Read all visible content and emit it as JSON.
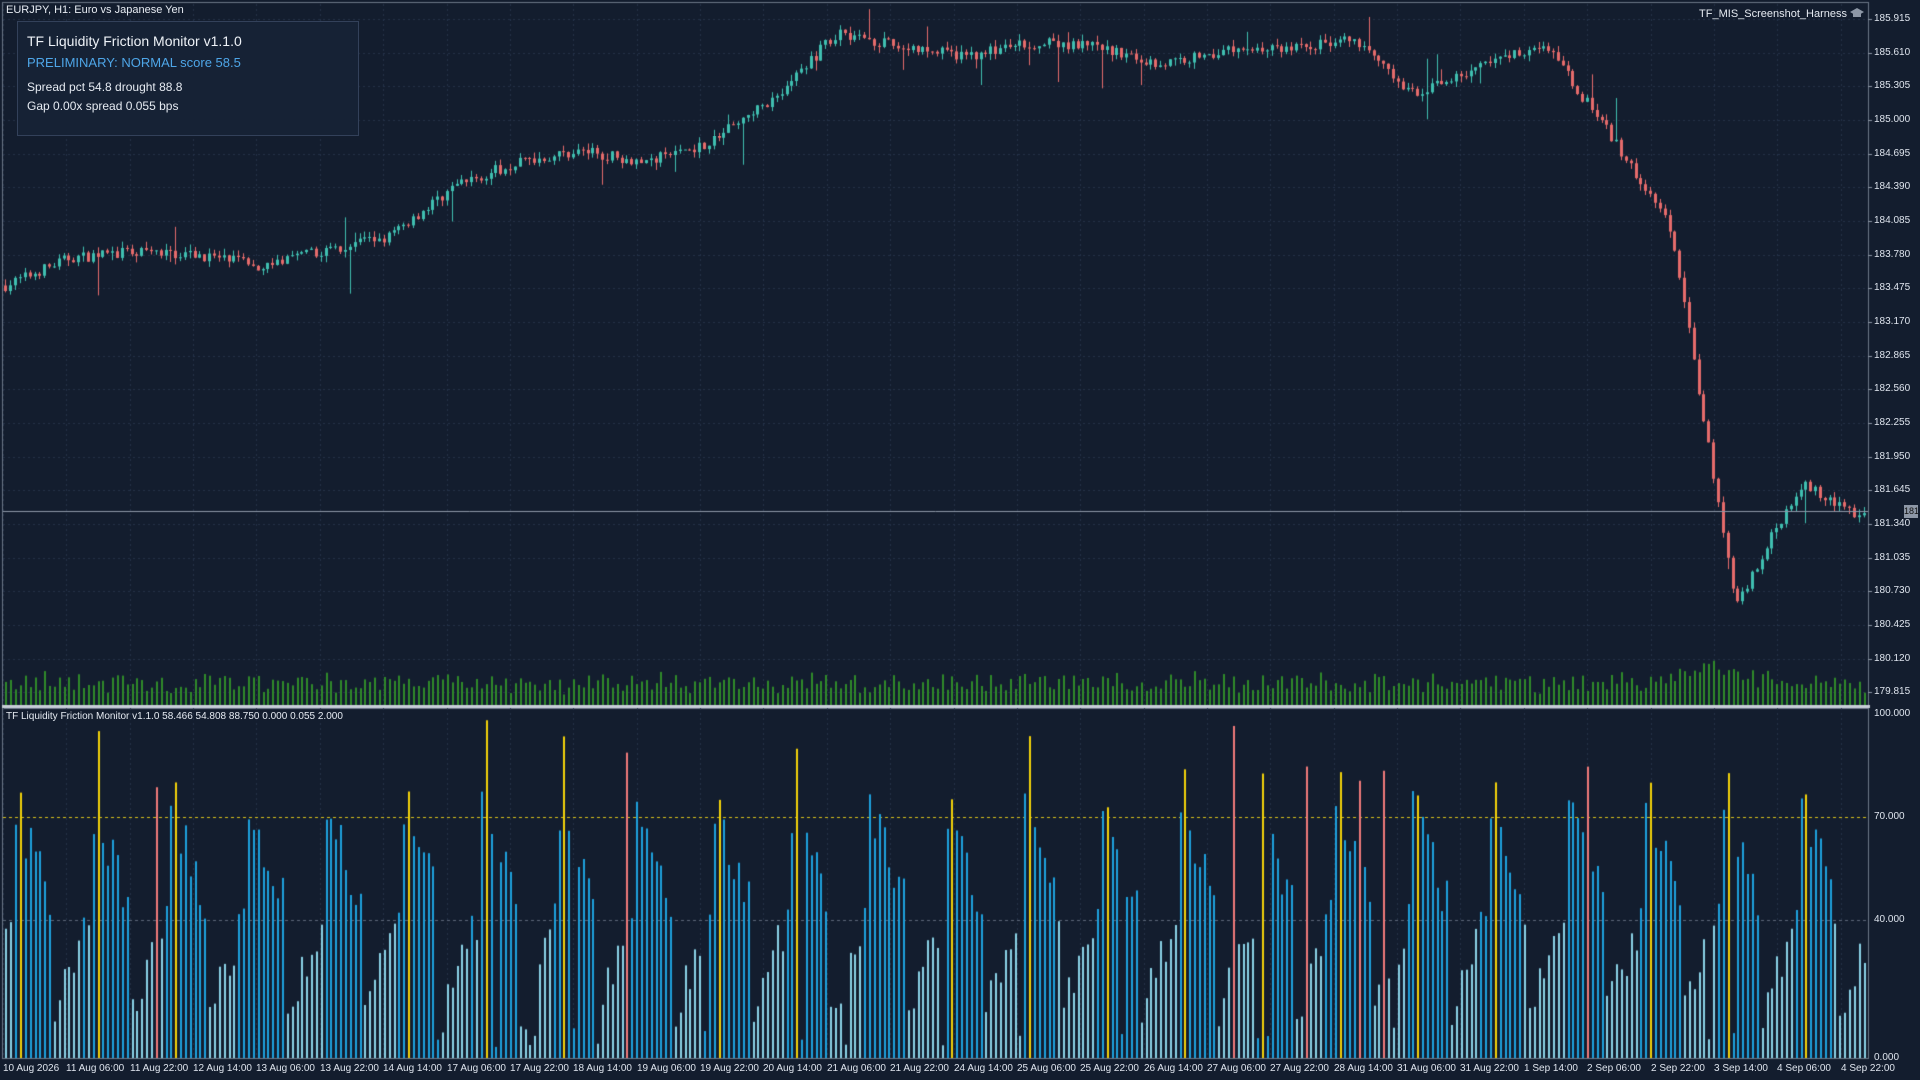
{
  "chart_title": "EURJPY, H1:  Euro vs Japanese Yen",
  "harness_label": "TF_MIS_Screenshot_Harness",
  "harness_icon": "graduation-cap-icon",
  "panel": {
    "title": "TF Liquidity Friction Monitor  v1.1.0",
    "status": "PRELIMINARY: NORMAL  score 58.5",
    "line1": "Spread pct 54.8   drought 88.8",
    "line2": "Gap 0.00x   spread 0.055 bps"
  },
  "subwindow_title": "TF Liquidity Friction Monitor v1.1.0 58.466 54.808 88.750 0.000 0.055 2.000",
  "current_price": "181.4??",
  "colors": {
    "background": "#131d2e",
    "bull_candle": "#3fbfb0",
    "bear_candle": "#e56b6b",
    "volume": "#2f8a2a",
    "bar_blue": "#1ea0dc",
    "bar_light": "#8ad2e6",
    "bar_yellow": "#f2d20a",
    "bar_red": "#f07a7a",
    "level_70": "#d9c21a"
  },
  "price_axis": [
    "185.915",
    "185.610",
    "185.305",
    "185.000",
    "184.695",
    "184.390",
    "184.085",
    "183.780",
    "183.475",
    "183.170",
    "182.865",
    "182.560",
    "182.255",
    "181.950",
    "181.645",
    "181.340",
    "181.035",
    "180.730",
    "180.425",
    "180.120",
    "179.815"
  ],
  "indicator_axis": [
    "100.000",
    "70.000",
    "40.000",
    "0.000"
  ],
  "time_axis": [
    "10 Aug 2026",
    "11 Aug 06:00",
    "11 Aug 22:00",
    "12 Aug 14:00",
    "13 Aug 06:00",
    "13 Aug 22:00",
    "14 Aug 14:00",
    "17 Aug 06:00",
    "17 Aug 22:00",
    "18 Aug 14:00",
    "19 Aug 06:00",
    "19 Aug 22:00",
    "20 Aug 14:00",
    "21 Aug 06:00",
    "21 Aug 22:00",
    "24 Aug 14:00",
    "25 Aug 06:00",
    "25 Aug 22:00",
    "26 Aug 14:00",
    "27 Aug 06:00",
    "27 Aug 22:00",
    "28 Aug 14:00",
    "31 Aug 06:00",
    "31 Aug 22:00",
    "1 Sep 14:00",
    "2 Sep 06:00",
    "2 Sep 22:00",
    "3 Sep 14:00",
    "4 Sep 06:00",
    "4 Sep 22:00"
  ],
  "chart_data": [
    {
      "type": "candlestick",
      "title": "EURJPY, H1:  Euro vs Japanese Yen",
      "timeframe": "H1",
      "x_range": [
        "10 Aug 2026",
        "4 Sep 22:00"
      ],
      "ylim": [
        179.7,
        186.05
      ],
      "approx_close_path": {
        "x": [
          "10 Aug 2026",
          "11 Aug 06:00",
          "11 Aug 22:00",
          "12 Aug 14:00",
          "13 Aug 06:00",
          "13 Aug 22:00",
          "14 Aug 14:00",
          "17 Aug 06:00",
          "17 Aug 22:00",
          "18 Aug 14:00",
          "19 Aug 06:00",
          "19 Aug 22:00",
          "20 Aug 14:00",
          "21 Aug 06:00",
          "21 Aug 22:00",
          "24 Aug 14:00",
          "25 Aug 06:00",
          "25 Aug 22:00",
          "26 Aug 14:00",
          "27 Aug 06:00",
          "27 Aug 22:00",
          "28 Aug 14:00",
          "31 Aug 06:00",
          "31 Aug 22:00",
          "1 Sep 14:00",
          "2 Sep 06:00",
          "2 Sep 22:00",
          "3 Sep 14:00",
          "4 Sep 06:00",
          "4 Sep 22:00"
        ],
        "y": [
          183.5,
          183.75,
          183.8,
          183.78,
          183.68,
          183.82,
          183.95,
          184.4,
          184.62,
          184.72,
          184.62,
          184.8,
          185.2,
          185.8,
          185.65,
          185.58,
          185.7,
          185.66,
          185.5,
          185.63,
          185.65,
          185.72,
          185.22,
          185.48,
          185.7,
          184.9,
          184.0,
          180.6,
          181.7,
          181.4
        ]
      },
      "current_price_line": 181.46
    },
    {
      "type": "bar",
      "title": "TF Liquidity Friction Monitor v1.1.0",
      "values_shown": [
        58.466,
        54.808,
        88.75,
        0.0,
        0.055,
        2.0
      ],
      "ylim": [
        0,
        100
      ],
      "levels": [
        70,
        40
      ],
      "x_range": [
        "10 Aug 2026",
        "4 Sep 22:00"
      ],
      "bar_count": 384,
      "pattern": "cyclical daily liquidity score: low light-blue bars rising to a peak each session (blue), with yellow spikes of 75-100 roughly once per day and occasional red spikes",
      "color_legend_by_value": {
        "below_40": "light-blue",
        "40_to_70": "blue",
        "spike": "yellow",
        "extreme": "red"
      }
    }
  ]
}
